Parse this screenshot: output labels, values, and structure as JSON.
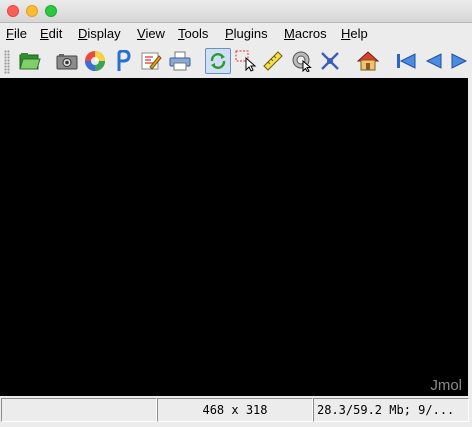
{
  "window": {
    "traffic_lights": [
      "close",
      "minimize",
      "zoom"
    ]
  },
  "menubar": {
    "items": [
      {
        "mnemonic": "F",
        "rest": "ile"
      },
      {
        "mnemonic": "E",
        "rest": "dit"
      },
      {
        "mnemonic": "D",
        "rest": "isplay"
      },
      {
        "mnemonic": "V",
        "rest": "iew"
      },
      {
        "mnemonic": "T",
        "rest": "ools"
      },
      {
        "mnemonic": "P",
        "rest": "lugins"
      },
      {
        "mnemonic": "M",
        "rest": "acros"
      },
      {
        "mnemonic": "H",
        "rest": "elp"
      }
    ]
  },
  "toolbar": {
    "buttons": [
      {
        "icon": "open-folder-icon"
      },
      {
        "icon": "camera-icon"
      },
      {
        "icon": "pov-ray-icon"
      },
      {
        "icon": "pdb-icon"
      },
      {
        "icon": "script-editor-icon"
      },
      {
        "icon": "printer-icon"
      },
      {
        "icon": "rotate-icon",
        "pressed": true
      },
      {
        "icon": "pick-icon"
      },
      {
        "icon": "ruler-icon"
      },
      {
        "icon": "spin-icon"
      },
      {
        "icon": "modelkit-icon"
      },
      {
        "icon": "home-icon"
      },
      {
        "icon": "first-frame-icon"
      },
      {
        "icon": "previous-frame-icon"
      },
      {
        "icon": "next-frame-icon"
      }
    ]
  },
  "viewer": {
    "background": "#000000",
    "watermark": "Jmol"
  },
  "status": {
    "cell1": "",
    "dimensions": "468 x 318",
    "memory": "28.3/59.2 Mb;   9/..."
  }
}
